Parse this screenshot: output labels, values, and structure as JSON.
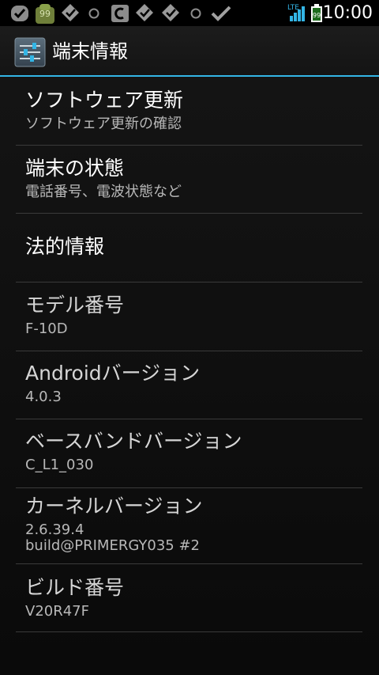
{
  "status_bar": {
    "time": "10:00",
    "notification_badge": "99",
    "battery_level": "99",
    "network_type": "LTE",
    "icons": [
      "check-circle-icon",
      "android-app-icon",
      "feedly-icon",
      "sync-icon",
      "c-app-icon",
      "feedly-icon",
      "feedly-icon",
      "sync-icon",
      "checkmark-icon",
      "signal-icon",
      "battery-icon"
    ]
  },
  "action_bar": {
    "title": "端末情報",
    "icon": "settings-icon",
    "accent_color": "#33b5e5"
  },
  "items": [
    {
      "title": "ソフトウェア更新",
      "summary": "ソフトウェア更新の確認"
    },
    {
      "title": "端末の状態",
      "summary": "電話番号、電波状態など"
    },
    {
      "title": "法的情報",
      "summary": ""
    },
    {
      "title": "モデル番号",
      "summary": "F-10D"
    },
    {
      "title": "Androidバージョン",
      "summary": "4.0.3"
    },
    {
      "title": "ベースバンドバージョン",
      "summary": "C_L1_030"
    },
    {
      "title": "カーネルバージョン",
      "summary": "2.6.39.4",
      "summary_line2": "build@PRIMERGY035 #2"
    },
    {
      "title": "ビルド番号",
      "summary": "V20R47F"
    }
  ]
}
